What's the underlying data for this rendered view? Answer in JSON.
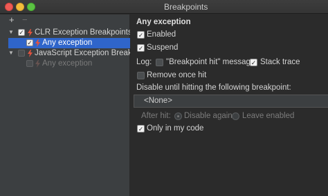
{
  "window": {
    "title": "Breakpoints"
  },
  "toolbar": {
    "add": "+",
    "remove": "−"
  },
  "tree": [
    {
      "label": "CLR Exception Breakpoints",
      "checked": true,
      "expanded": true
    },
    {
      "label": "Any exception",
      "checked": true,
      "selected": true
    },
    {
      "label": "JavaScript Exception Breakpoints",
      "checked": false,
      "expanded": true
    },
    {
      "label": "Any exception",
      "checked": false,
      "disabled": true
    }
  ],
  "details": {
    "heading": "Any exception",
    "enabled_label": "Enabled",
    "suspend_label": "Suspend",
    "log_label": "Log:",
    "log_message_label": "\"Breakpoint hit\" message",
    "stack_trace_label": "Stack trace",
    "remove_once_hit_label": "Remove once hit",
    "disable_until_label": "Disable until hitting the following breakpoint:",
    "disable_until_value": "<None>",
    "after_hit_label": "After hit:",
    "disable_again_label": "Disable again",
    "leave_enabled_label": "Leave enabled",
    "only_my_code_label": "Only in my code"
  },
  "state": {
    "enabled": true,
    "suspend": true,
    "log_message": false,
    "stack_trace": true,
    "remove_once_hit": false,
    "only_my_code": true
  },
  "colors": {
    "selection": "#2f65ca",
    "exception_icon": "#e0533f"
  }
}
